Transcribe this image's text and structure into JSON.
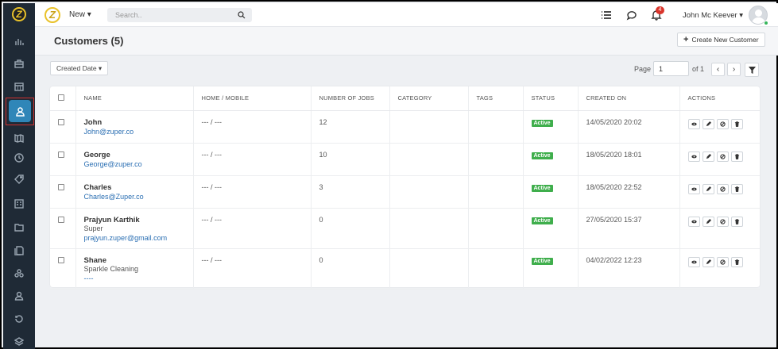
{
  "app": {
    "logo_letter": "Z",
    "new_menu_label": "New ▾",
    "search_placeholder": "Search..",
    "notification_count": "4",
    "user_name": "John Mc Keever ▾"
  },
  "sidebar": {
    "items": [
      {
        "name": "reports-icon"
      },
      {
        "name": "jobs-icon"
      },
      {
        "name": "calendar-icon"
      },
      {
        "name": "customers-icon",
        "active": true
      },
      {
        "name": "map-icon"
      },
      {
        "name": "timesheet-icon"
      },
      {
        "name": "tags-icon"
      },
      {
        "name": "quotes-icon"
      },
      {
        "name": "folder-icon"
      },
      {
        "name": "invoices-icon"
      },
      {
        "name": "team-icon"
      },
      {
        "name": "user-icon"
      },
      {
        "name": "history-icon"
      },
      {
        "name": "layers-icon"
      }
    ]
  },
  "page": {
    "title": "Customers (5)",
    "create_button": "Create New Customer",
    "sort_dropdown": "Created Date ▾",
    "pager_label": "Page",
    "pager_value": "1",
    "pager_of": "of 1"
  },
  "table": {
    "columns": [
      "NAME",
      "HOME / MOBILE",
      "NUMBER OF JOBS",
      "CATEGORY",
      "TAGS",
      "STATUS",
      "CREATED ON",
      "ACTIONS"
    ],
    "rows": [
      {
        "name": "John",
        "sub": "",
        "email": "John@zuper.co",
        "phone": "--- / ---",
        "jobs": "12",
        "category": "",
        "tags": "",
        "status": "Active",
        "created": "14/05/2020 20:02"
      },
      {
        "name": "George",
        "sub": "",
        "email": "George@zuper.co",
        "phone": "--- / ---",
        "jobs": "10",
        "category": "",
        "tags": "",
        "status": "Active",
        "created": "18/05/2020 18:01"
      },
      {
        "name": "Charles",
        "sub": "",
        "email": "Charles@Zuper.co",
        "phone": "--- / ---",
        "jobs": "3",
        "category": "",
        "tags": "",
        "status": "Active",
        "created": "18/05/2020 22:52"
      },
      {
        "name": "Prajyun Karthik",
        "sub": "Super",
        "email": "prajyun.zuper@gmail.com",
        "phone": "--- / ---",
        "jobs": "0",
        "category": "",
        "tags": "",
        "status": "Active",
        "created": "27/05/2020 15:37"
      },
      {
        "name": "Shane",
        "sub": "Sparkle Cleaning",
        "email": "----",
        "phone": "--- / ---",
        "jobs": "0",
        "category": "",
        "tags": "",
        "status": "Active",
        "created": "04/02/2022 12:23"
      }
    ]
  },
  "colors": {
    "sidebar_bg": "#1f2a36",
    "active_item": "#2f86b8",
    "status_active": "#3fae4c",
    "link": "#2b6fb3",
    "badge": "#d9342b"
  }
}
